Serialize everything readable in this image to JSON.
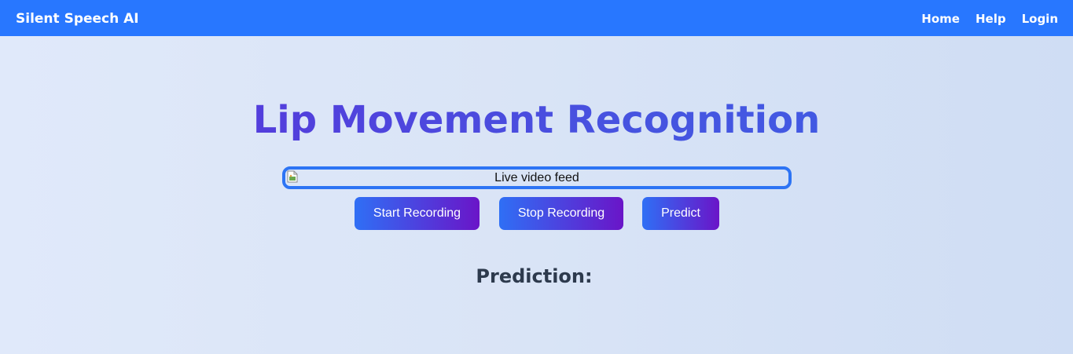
{
  "navbar": {
    "brand": "Silent Speech AI",
    "links": [
      {
        "label": "Home"
      },
      {
        "label": "Help"
      },
      {
        "label": "Login"
      }
    ],
    "background_color": "#2877ff"
  },
  "main": {
    "title": "Lip Movement Recognition",
    "video_feed": {
      "alt": "Live video feed",
      "border_color": "#2d74f4",
      "icon": "broken-image-icon"
    },
    "buttons": {
      "start": "Start Recording",
      "stop": "Stop Recording",
      "predict": "Predict"
    },
    "prediction": {
      "label": "Prediction:",
      "value": ""
    }
  },
  "colors": {
    "accent_start": "#2f6ff5",
    "accent_end": "#6a15c8",
    "title_gradient_start": "#5b2fd9",
    "title_gradient_end": "#3d60e6",
    "text_dark": "#2d3a4d"
  }
}
